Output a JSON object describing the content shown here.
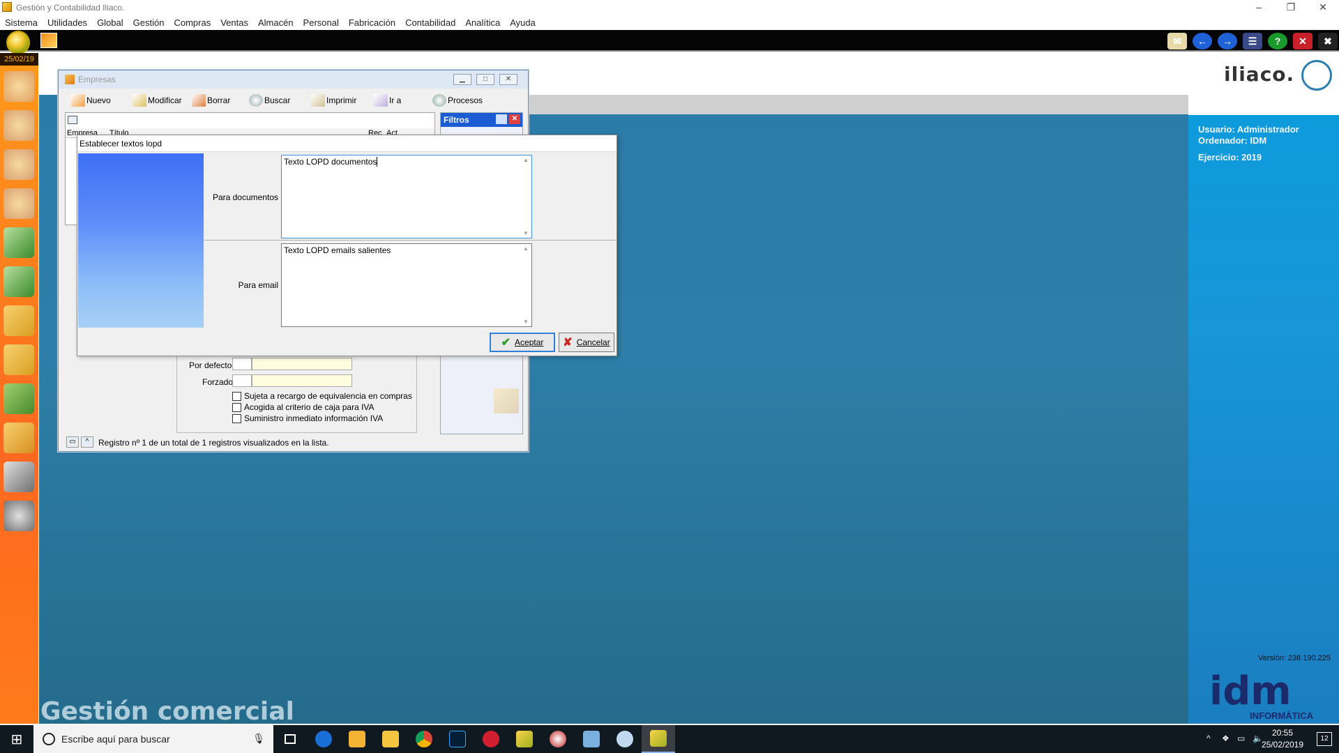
{
  "window": {
    "title": "Gestión y Contabilidad Iliaco.",
    "controls": [
      "–",
      "❐",
      "✕"
    ]
  },
  "menu": [
    "Sistema",
    "Utilidades",
    "Global",
    "Gestión",
    "Compras",
    "Ventas",
    "Almacén",
    "Personal",
    "Fabricación",
    "Contabilidad",
    "Analítica",
    "Ayuda"
  ],
  "sidebar": {
    "date": "25/02/19"
  },
  "empresas": {
    "title": "Empresas",
    "toolbar": [
      "Nuevo",
      "Modificar",
      "Borrar",
      "Buscar",
      "Imprimir",
      "Ir a",
      "Procesos"
    ],
    "columns": [
      "Empresa",
      "Título",
      "Rec.",
      "Act."
    ],
    "filters_title": "Filtros",
    "form": {
      "por_defecto_label": "Por defecto",
      "forzado_label": "Forzado",
      "checks": [
        {
          "label": "Sujeta a recargo de equivalencia en compras",
          "checked": false
        },
        {
          "label": "Acogida al criterio de caja para IVA",
          "checked": false
        },
        {
          "label": "Suministro inmediato información IVA",
          "checked": false
        }
      ]
    },
    "status": "Registro nº 1 de un total de 1 registros visualizados en la lista."
  },
  "dialog": {
    "title": "Establecer textos lopd",
    "documentos_label": "Para documentos",
    "documentos_value": "Texto LOPD documentos",
    "email_label": "Para email",
    "email_value": "Texto LOPD emails salientes",
    "accept_label": "Aceptar",
    "cancel_label": "Cancelar"
  },
  "info": {
    "usuario": "Usuario: Administrador",
    "ordenador": "Ordenador: IDM",
    "ejercicio": "Ejercicio: 2019",
    "version": "Versión: 238 190.225",
    "logo": "iliaco.",
    "idm_logo": "idm",
    "idm_sub": "INFORMÁTICA"
  },
  "watermark": "Gestión comercial",
  "taskbar": {
    "search_placeholder": "Escribe aquí para buscar",
    "time": "20:55",
    "date": "25/02/2019",
    "notifications": "12"
  },
  "colors": {
    "desk": "#2b7ba9",
    "sidebar": "#ff7a1a",
    "info_panel": "#1796d8",
    "filtros_header": "#1b5bd3"
  }
}
